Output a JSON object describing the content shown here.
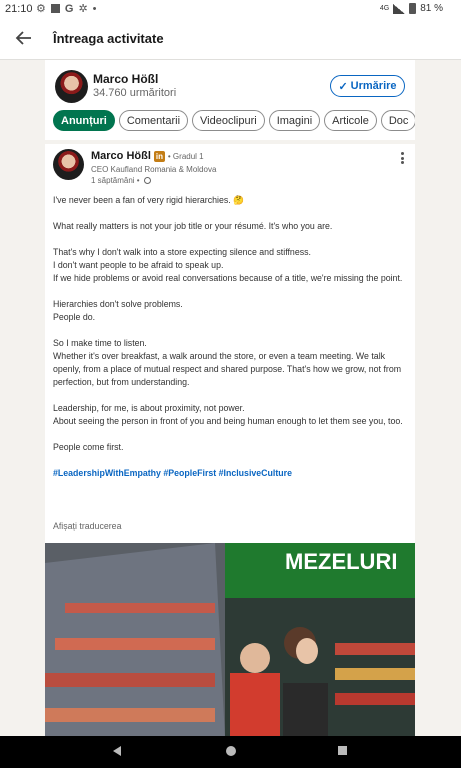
{
  "status": {
    "time": "21:10",
    "network": "4G",
    "battery": "81 %"
  },
  "header": {
    "title": "Întreaga activitate"
  },
  "profile": {
    "name": "Marco Hößl",
    "followers": "34.760 urmăritori",
    "follow_label": "Urmărire"
  },
  "tabs": [
    "Anunțuri",
    "Comentarii",
    "Videoclipuri",
    "Imagini",
    "Articole",
    "Doc"
  ],
  "post": {
    "author": "Marco Hößl",
    "badge": "in",
    "degree": "• Gradul 1",
    "headline": "CEO Kaufland Romania & Moldova",
    "time": "1 săptămâni •",
    "paragraphs": [
      "I've never been a fan of very rigid hierarchies. 🤔",
      "What really matters is not your job title or your résumé. It's who you are.",
      "That's why I don't walk into a store expecting silence and stiffness.\nI don't want people to be afraid to speak up.\nIf we hide problems or avoid real conversations because of a title, we're missing the point.",
      "Hierarchies don't solve problems.\nPeople do.",
      "So I make time to listen.\nWhether it's over breakfast, a walk around the store, or even a team meeting. We talk openly, from a place of mutual respect and shared purpose. That's how we grow, not from perfection, but from understanding.",
      "Leadership, for me, is about proximity, not power.\nAbout seeing the person in front of you and being human enough to let them see you, too.",
      "People come first."
    ],
    "hashtags": "#LeadershipWithEmpathy #PeopleFirst #InclusiveCulture",
    "translate": "Afișați traducerea",
    "photo_sign": "MEZELURI"
  }
}
